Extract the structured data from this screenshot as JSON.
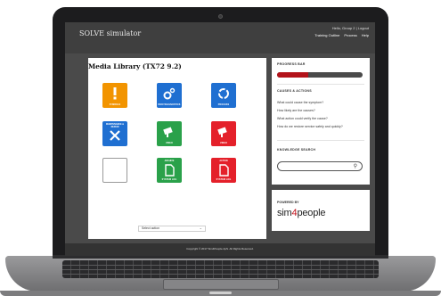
{
  "header": {
    "brand": "SOLVE simulator",
    "user_text": "Hello, Group 2 | Logout",
    "nav": [
      "Training Outline",
      "Process",
      "Help"
    ]
  },
  "main": {
    "title": "Media Library (TX72 9.2)",
    "tiles": [
      {
        "label": "SYMBOLS",
        "color": "#f29400",
        "icon": "exclamation-icon"
      },
      {
        "label": "BODYDIAGNOSTICS",
        "color": "#1f6fd1",
        "icon": "gears-icon"
      },
      {
        "label": "PROCESS",
        "color": "#1f6fd1",
        "icon": "cycle-icon"
      },
      {
        "label": "MAINTENANCE & REPAIR",
        "color": "#1f6fd1",
        "icon": "tools-icon"
      },
      {
        "label": "VIDEO",
        "color": "#2aa14a",
        "icon": "camera-icon"
      },
      {
        "label": "VIDEO",
        "color": "#e4202a",
        "icon": "camera-icon"
      },
      {
        "label": "",
        "color": "#ffffff",
        "icon": "empty-icon"
      },
      {
        "label": "SYSTEM LOG",
        "label_top": "ARCHIVE",
        "color": "#2aa14a",
        "icon": "document-icon"
      },
      {
        "label": "SYSTEM LOG",
        "label_top": "ACTION",
        "color": "#e4202a",
        "icon": "document-icon"
      }
    ],
    "select_value": "Select action"
  },
  "sidebar": {
    "progress_title": "PROGRESS BAR",
    "progress_value": 0.36,
    "causes_title": "CAUSES & ACTIONS",
    "causes": [
      "What could cause the symptom?",
      "How likely are the causes?",
      "What action could verify the cause?",
      "How do we restore service safely and quickly?"
    ],
    "search_title": "KNOWLEDGE SEARCH",
    "search_placeholder": "",
    "powered_label": "POWERED BY",
    "logo_prefix": "sim",
    "logo_mid": "4",
    "logo_suffix": "people"
  },
  "footer": {
    "copyright": "Copyright © 2017 Sim4People ApS. All Rights Reserved."
  },
  "colors": {
    "progress": "#b3121a",
    "accent_red": "#c0111a"
  }
}
